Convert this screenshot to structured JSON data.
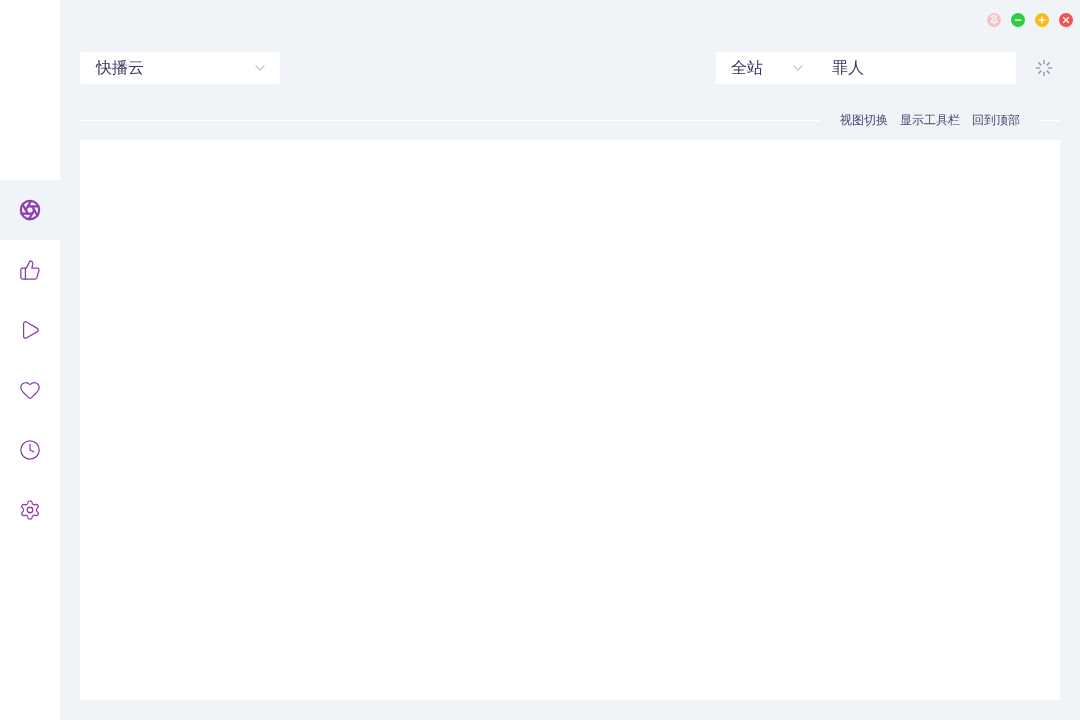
{
  "window_controls": [
    {
      "kind": "pin",
      "disabled": true
    },
    {
      "kind": "minimize",
      "disabled": false
    },
    {
      "kind": "maximize",
      "disabled": false
    },
    {
      "kind": "close",
      "disabled": false
    }
  ],
  "sidebar": {
    "items": [
      {
        "kind": "aperture",
        "selected": true
      },
      {
        "kind": "like",
        "selected": false
      },
      {
        "kind": "play",
        "selected": false
      },
      {
        "kind": "heart",
        "selected": false
      },
      {
        "kind": "clock",
        "selected": false
      },
      {
        "kind": "settings",
        "selected": false
      }
    ]
  },
  "source_select": {
    "value": "快播云"
  },
  "search": {
    "scope": "全站",
    "value": "罪人",
    "loading": true
  },
  "toolbar_links": [
    "视图切换",
    "显示工具栏",
    "回到顶部"
  ]
}
